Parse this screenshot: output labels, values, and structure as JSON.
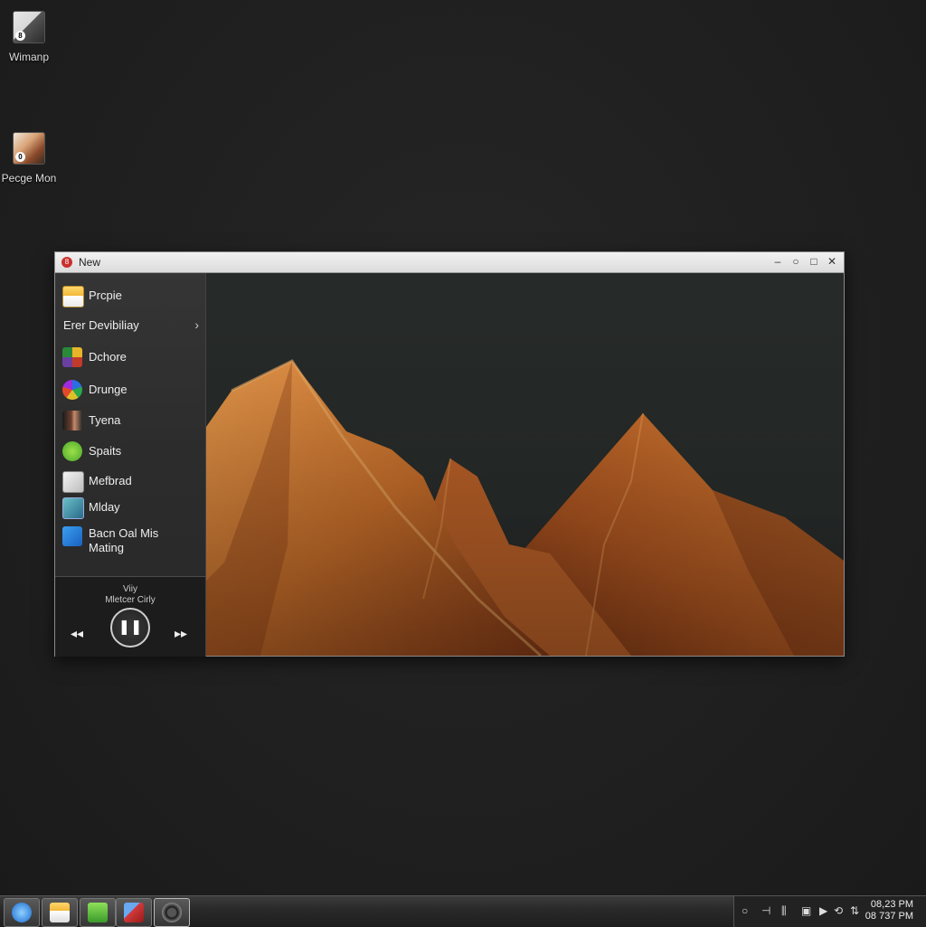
{
  "desktop": {
    "icons": [
      {
        "label": "Wimanp",
        "badge": "8"
      },
      {
        "label": "Pecge Mon",
        "badge": "0"
      }
    ]
  },
  "window": {
    "title": "New",
    "app_icon_glyph": "8",
    "controls": {
      "minimize": "–",
      "restore": "○",
      "maximize": "□",
      "close": "✕"
    }
  },
  "sidebar": {
    "top_item": {
      "label": "Prcpie",
      "icon": "folder-icon"
    },
    "heading": "Erer Devibiliay",
    "heading_chevron": "›",
    "items": [
      {
        "label": "Dchore",
        "icon": "game-icon"
      },
      {
        "label": "Drunge",
        "icon": "colorful-ball-icon"
      },
      {
        "label": "Tyena",
        "icon": "portrait-icon"
      },
      {
        "label": "Spaits",
        "icon": "chat-icon"
      },
      {
        "label": "Mefbrad",
        "icon": "document-icon"
      },
      {
        "label": "Mlday",
        "icon": "image-icon"
      },
      {
        "label": "Bacn Oal Mis",
        "label2": "Mating",
        "icon": "windows-logo-icon"
      }
    ]
  },
  "player": {
    "line1": "Viiy",
    "line2": "Mletcer Cirly",
    "prev": "◂◂",
    "pause": "❚❚",
    "next": "▸▸"
  },
  "taskbar": {
    "apps": [
      {
        "icon": "start-orb-icon"
      },
      {
        "icon": "file-explorer-icon"
      },
      {
        "icon": "phone-icon"
      },
      {
        "icon": "red-app-icon"
      },
      {
        "icon": "camera-icon"
      }
    ],
    "tray": {
      "glyphs": [
        "○",
        "⊣",
        "⫼",
        "▣",
        "▶",
        "⟲",
        "⇅"
      ],
      "time": "08,23 PM",
      "date": "08 737 PM"
    }
  },
  "colors": {
    "desktop_bg": "#202020",
    "mountain_light": "#e88b3a",
    "mountain_dark": "#8a3c18",
    "sky": "#2a2f2d"
  }
}
